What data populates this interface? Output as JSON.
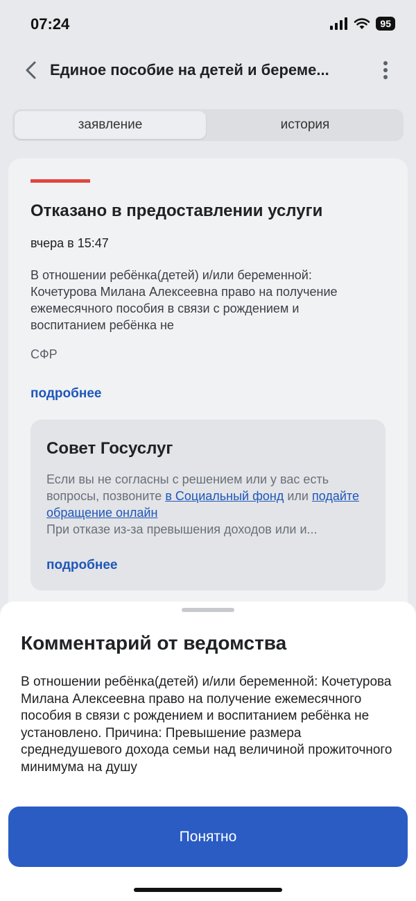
{
  "status_bar": {
    "time": "07:24",
    "battery": "95"
  },
  "header": {
    "title": "Единое пособие на детей и береме..."
  },
  "tabs": [
    {
      "label": "заявление"
    },
    {
      "label": "история"
    }
  ],
  "status_card": {
    "title": "Отказано в предоставлении услуги",
    "date": "вчера в 15:47",
    "text": "В отношении ребёнка(детей) и/или беременной: Кочетурова Милана Алексеевна право на получение ежемесячного пособия в связи с рождением и воспитанием ребёнка не",
    "source": "СФР",
    "more_label": "подробнее",
    "accent_color": "#e0473d"
  },
  "tip": {
    "title": "Совет Госуслуг",
    "text_part1": "Если вы не согласны с решением или у вас есть вопросы, позвоните ",
    "link1": "в Социальный фонд",
    "text_part2": " или ",
    "link2": "подайте обращение онлайн",
    "text_part3": "При отказе из-за превышения доходов или и...",
    "more_label": "подробнее"
  },
  "sheet": {
    "title": "Комментарий от ведомства",
    "text": "В отношении ребёнка(детей) и/или беременной: Кочетурова Милана Алексеевна право на получение ежемесячного пособия в связи с рождением и воспитанием ребёнка не установлено. Причина: Превышение размера среднедушевого дохода семьи над величиной прожиточного минимума на душу",
    "button_label": "Понятно",
    "button_color": "#2a5cc4"
  },
  "icons": {
    "back": "chevron-left-icon",
    "more": "more-vertical-icon",
    "signal": "signal-icon",
    "wifi": "wifi-icon",
    "battery": "battery-icon"
  }
}
